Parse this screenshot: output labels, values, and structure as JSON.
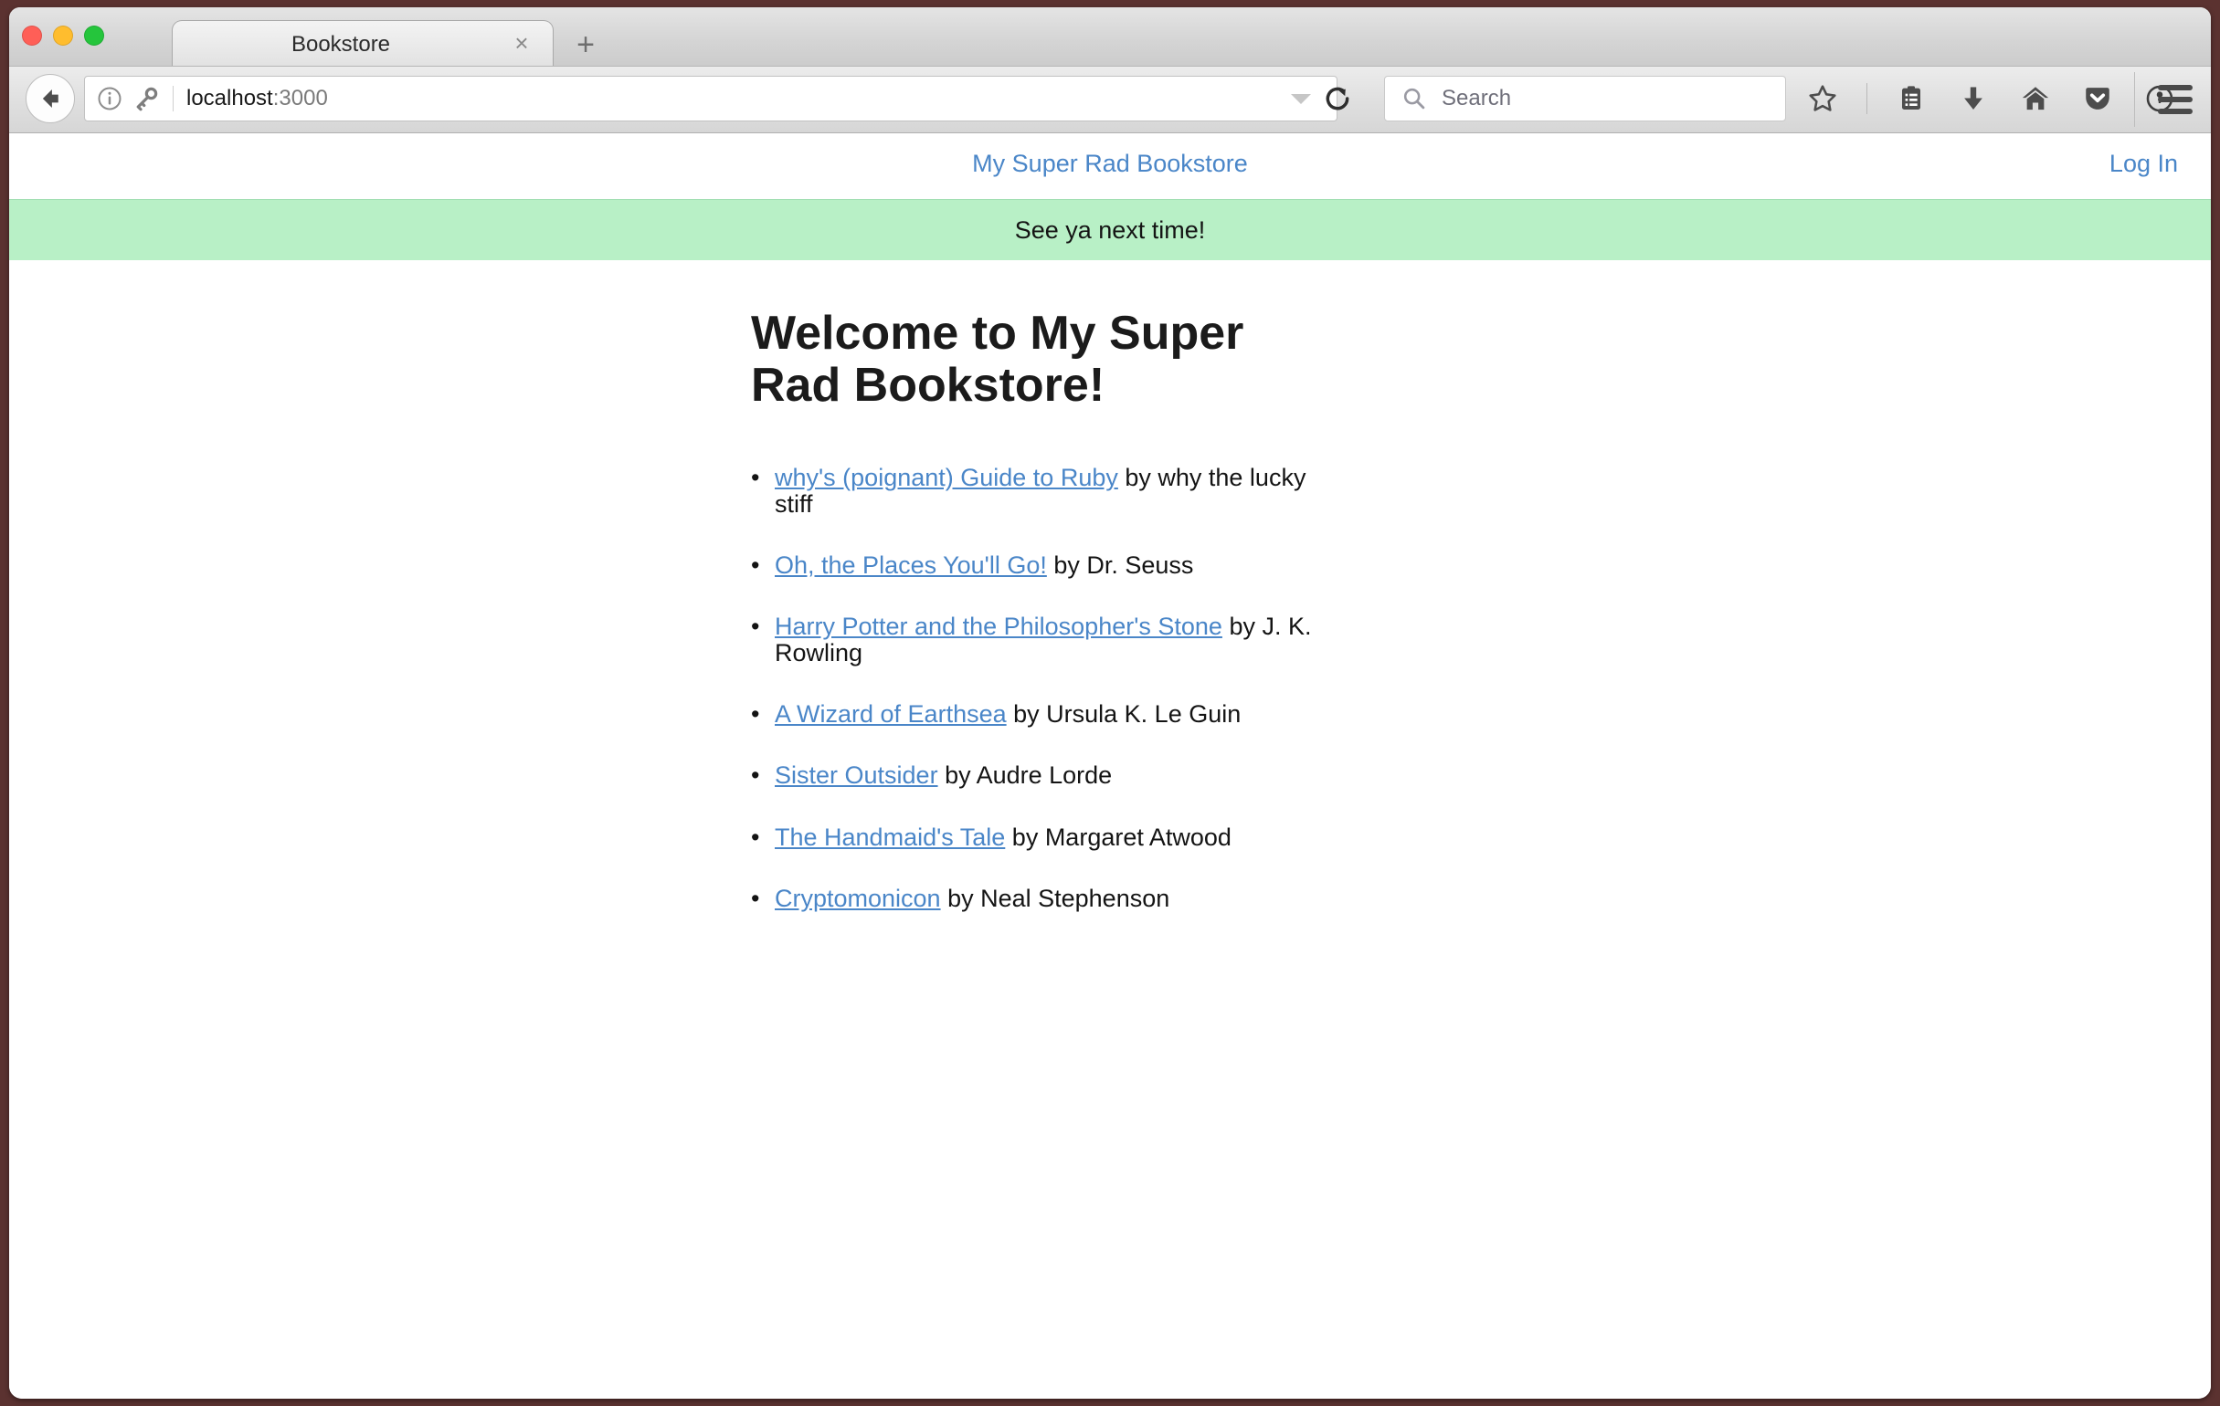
{
  "window": {
    "traffic_lights": [
      "close",
      "minimize",
      "zoom"
    ],
    "border_color": "#5b3230"
  },
  "browser": {
    "tab": {
      "title": "Bookstore",
      "close_label": "×"
    },
    "new_tab_label": "+",
    "toolbar": {
      "back_label": "Back",
      "url_host": "localhost",
      "url_port": ":3000",
      "dropdown_label": "History dropdown",
      "reload_label": "Reload",
      "search_placeholder": "Search",
      "icons": [
        {
          "name": "bookmark-star-icon",
          "label": "Bookmark this page"
        },
        {
          "name": "reading-list-icon",
          "label": "Show your bookmarks"
        },
        {
          "name": "downloads-icon",
          "label": "Downloads"
        },
        {
          "name": "home-icon",
          "label": "Home"
        },
        {
          "name": "pocket-icon",
          "label": "Save to Pocket"
        },
        {
          "name": "account-icon",
          "label": "Account"
        }
      ],
      "menu_label": "Open menu"
    }
  },
  "site": {
    "title": "My Super Rad Bookstore",
    "login_label": "Log In",
    "flash_message": "See ya next time!",
    "flash_color": "#b8f0c6",
    "link_color": "#4a86c8",
    "heading": "Welcome to My Super Rad Bookstore!",
    "books": [
      {
        "title": "why's (poignant) Guide to Ruby",
        "author": " by why the lucky stiff"
      },
      {
        "title": "Oh, the Places You'll Go!",
        "author": " by Dr. Seuss"
      },
      {
        "title": "Harry Potter and the Philosopher's Stone",
        "author": " by J. K. Rowling"
      },
      {
        "title": "A Wizard of Earthsea",
        "author": " by Ursula K. Le Guin"
      },
      {
        "title": "Sister Outsider",
        "author": " by Audre Lorde"
      },
      {
        "title": "The Handmaid's Tale",
        "author": " by Margaret Atwood"
      },
      {
        "title": "Cryptomonicon",
        "author": " by Neal Stephenson"
      }
    ]
  }
}
